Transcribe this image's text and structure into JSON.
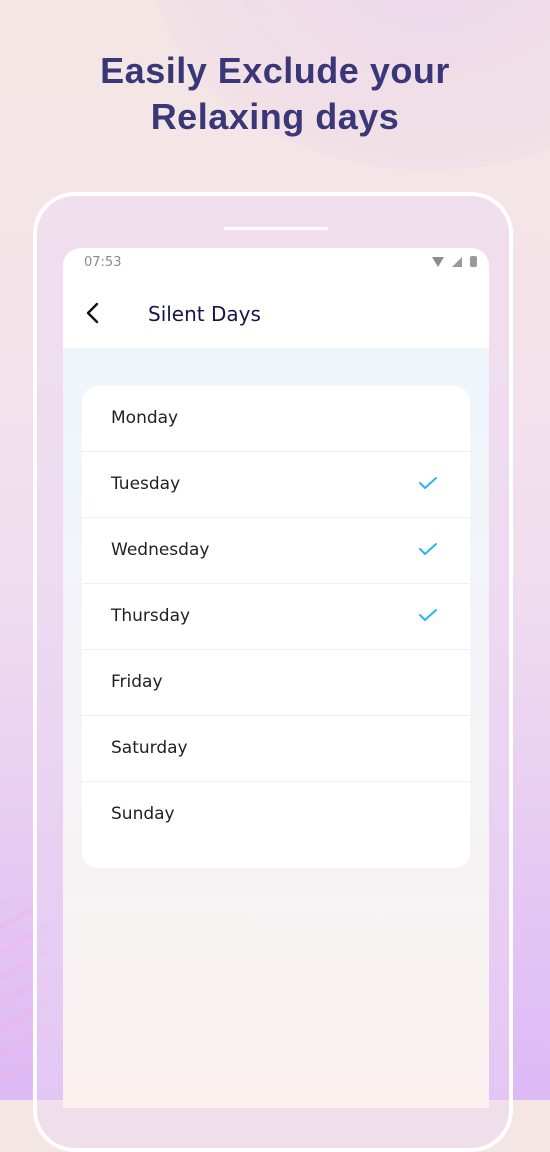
{
  "promo": {
    "headline_line1": "Easily Exclude your",
    "headline_line2": "Relaxing days"
  },
  "status_bar": {
    "time": "07:53",
    "icons": [
      "wifi-icon",
      "cell-signal-icon",
      "battery-icon"
    ]
  },
  "app_bar": {
    "back_icon": "chevron-left-icon",
    "title": "Silent Days"
  },
  "days": [
    {
      "label": "Monday",
      "selected": false
    },
    {
      "label": "Tuesday",
      "selected": true
    },
    {
      "label": "Wednesday",
      "selected": true
    },
    {
      "label": "Thursday",
      "selected": true
    },
    {
      "label": "Friday",
      "selected": false
    },
    {
      "label": "Saturday",
      "selected": false
    },
    {
      "label": "Sunday",
      "selected": false
    }
  ],
  "colors": {
    "headline": "#3a3778",
    "title": "#15164a",
    "check": "#29b6e8"
  }
}
